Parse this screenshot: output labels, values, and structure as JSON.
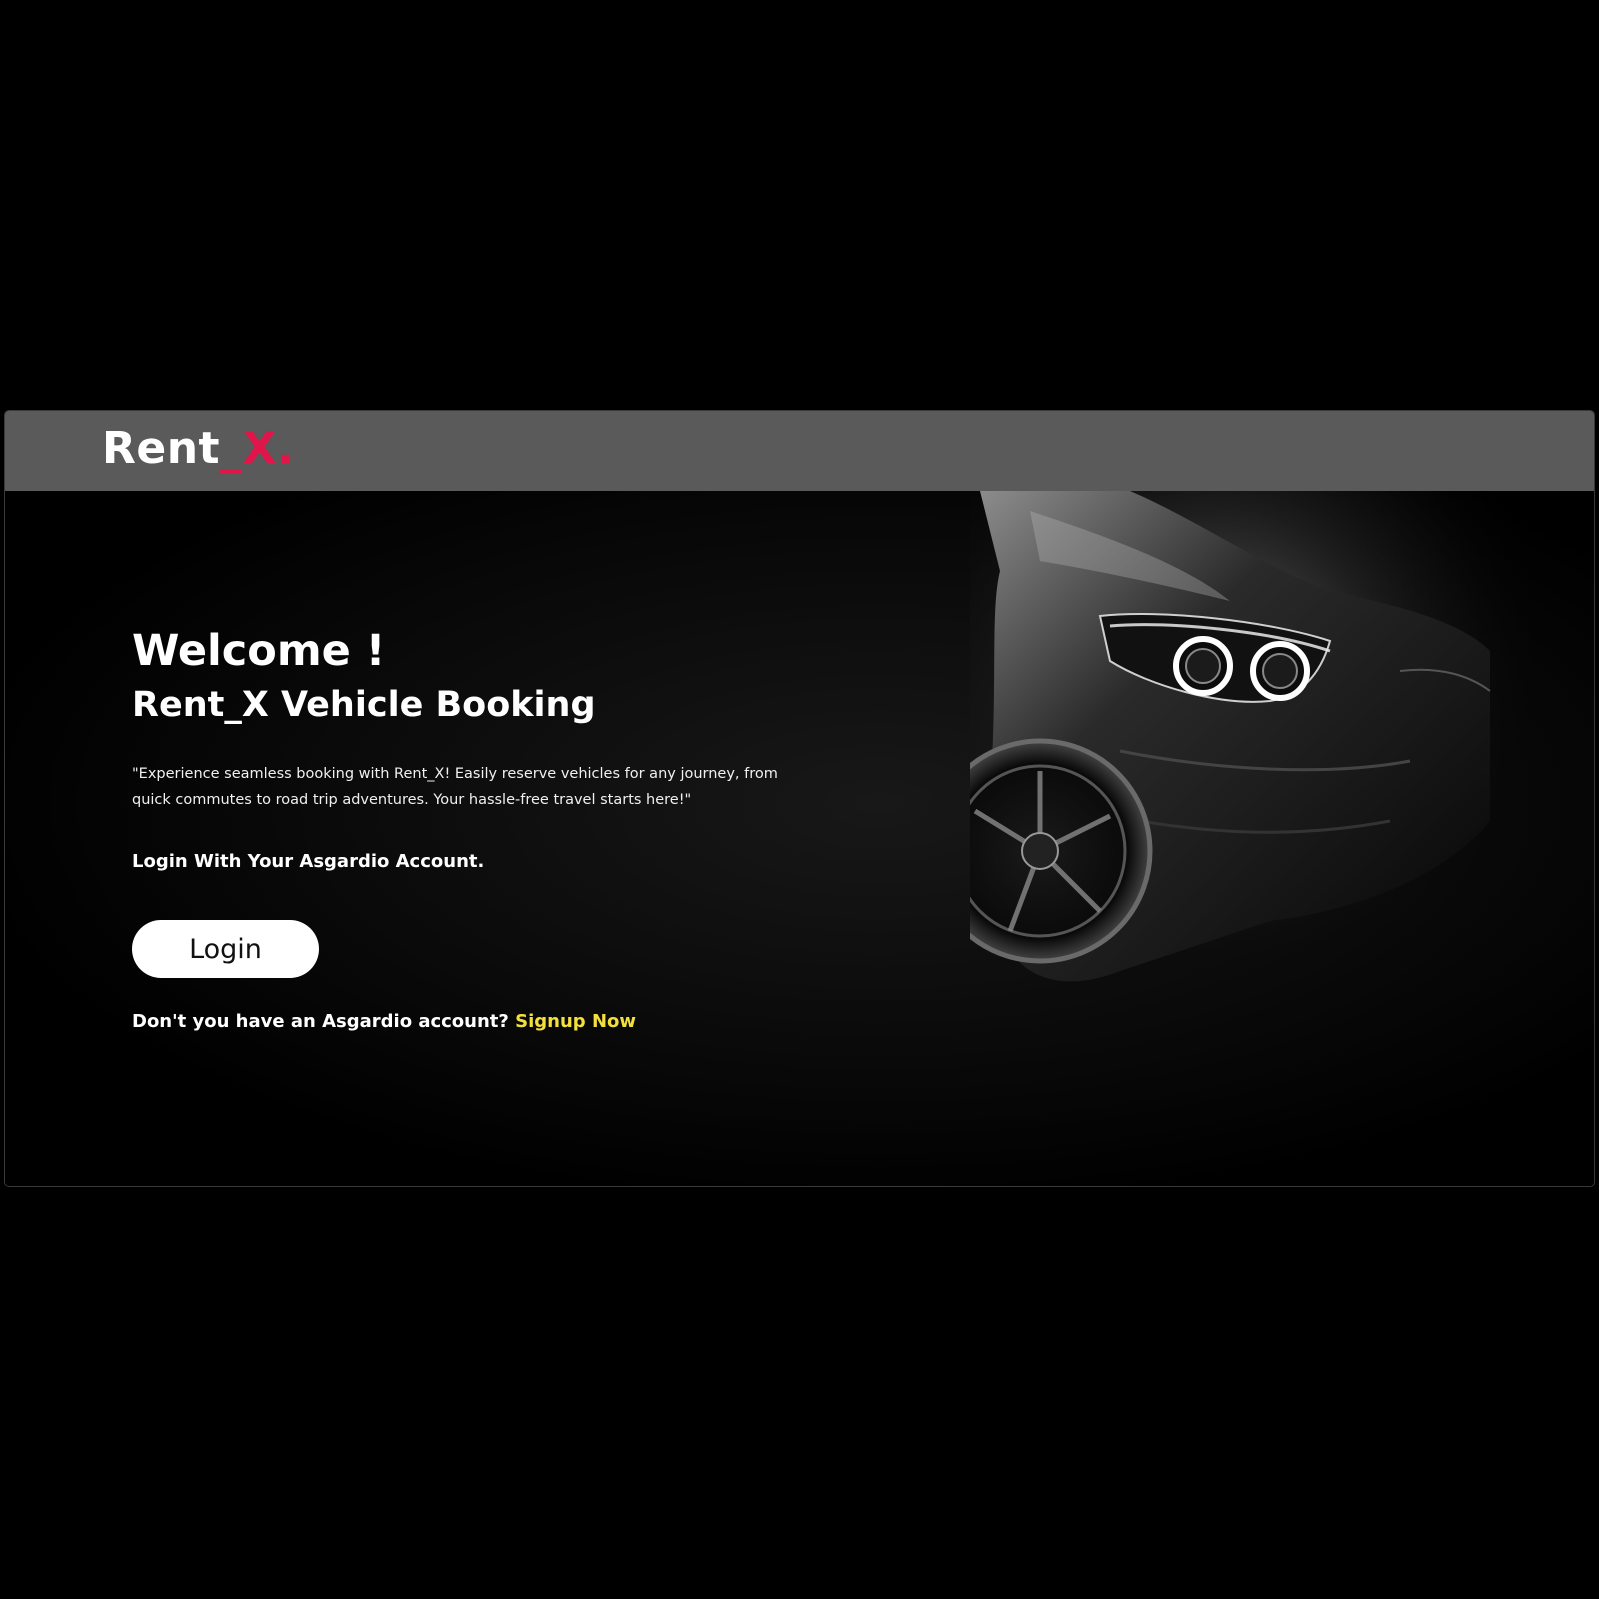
{
  "brand": {
    "name_main": "Rent",
    "name_accent": "_X.",
    "accent_color": "#e0154a"
  },
  "hero": {
    "welcome": "Welcome !",
    "subtitle": "Rent_X Vehicle Booking",
    "description": "\"Experience seamless booking with Rent_X! Easily reserve vehicles for any journey, from quick commutes to road trip adventures. Your hassle-free travel starts here!\"",
    "login_prompt": "Login With Your Asgardio Account.",
    "login_button": "Login",
    "signup_question": "Don't you have an Asgardio account?",
    "signup_link": "Signup Now",
    "signup_color": "#f4e03c"
  },
  "colors": {
    "navbar": "#5a5a5a",
    "background": "#000000",
    "button_bg": "#ffffff"
  }
}
